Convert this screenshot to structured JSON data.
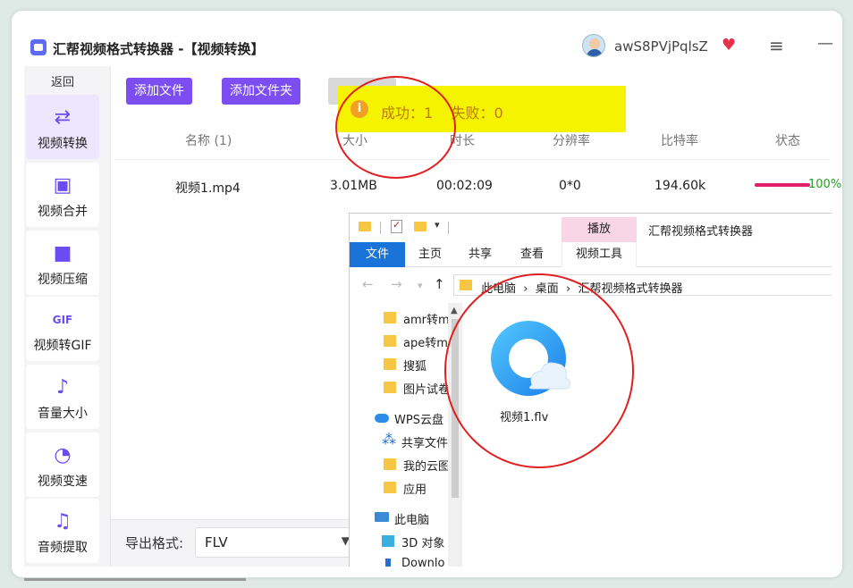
{
  "app": {
    "title": "汇帮视频格式转换器  -【视频转换】",
    "username": "awS8PVjPqlsZ",
    "vip_icon": "heart-diamond-icon",
    "menu_icon": "≡",
    "min_icon": "—"
  },
  "sidebar": {
    "back_label": "返回",
    "items": [
      {
        "label": "视频转换",
        "icon": "video-convert-icon",
        "glyph": "⇄"
      },
      {
        "label": "视频合并",
        "icon": "video-merge-icon",
        "glyph": "▣"
      },
      {
        "label": "视频压缩",
        "icon": "camera-icon",
        "glyph": "■"
      },
      {
        "label": "视频转GIF",
        "icon": "gif-icon",
        "glyph": "GIF"
      },
      {
        "label": "音量大小",
        "icon": "music-note-icon",
        "glyph": "♪"
      },
      {
        "label": "视频变速",
        "icon": "speedometer-icon",
        "glyph": "◔"
      },
      {
        "label": "音频提取",
        "icon": "music-extract-icon",
        "glyph": "♫"
      }
    ]
  },
  "toolbar": {
    "add_file": "添加文件",
    "add_folder": "添加文件夹"
  },
  "toast": {
    "icon": "i",
    "text": "成功：1    失败：0"
  },
  "table": {
    "headers": {
      "name": "名称 (1)",
      "size": "大小",
      "duration": "时长",
      "resolution": "分辨率",
      "bitrate": "比特率",
      "status": "状态"
    },
    "rows": [
      {
        "name": "视频1.mp4",
        "size": "3.01MB",
        "duration": "00:02:09",
        "resolution": "0*0",
        "bitrate": "194.60k",
        "status_text": "100%",
        "progress": 1.0
      }
    ]
  },
  "output": {
    "label": "导出格式:",
    "format": "FLV"
  },
  "explorer": {
    "title": "汇帮视频格式转换器",
    "context_tab": "播放",
    "ribbon_tabs": [
      "文件",
      "主页",
      "共享",
      "查看",
      "视频工具"
    ],
    "breadcrumb": "此电脑  ›  桌面  ›  汇帮视频格式转换器",
    "tree": [
      {
        "label": "amr转m",
        "icon": "folder-icon"
      },
      {
        "label": "ape转mp",
        "icon": "folder-icon"
      },
      {
        "label": "搜狐",
        "icon": "folder-icon"
      },
      {
        "label": "图片试卷",
        "icon": "folder-icon"
      },
      {
        "label": "WPS云盘",
        "icon": "cloud-icon"
      },
      {
        "label": "共享文件",
        "icon": "share-icon"
      },
      {
        "label": "我的云图",
        "icon": "folder-icon"
      },
      {
        "label": "应用",
        "icon": "folder-icon"
      },
      {
        "label": "此电脑",
        "icon": "computer-icon"
      },
      {
        "label": "3D 对象",
        "icon": "cube-icon"
      },
      {
        "label": "Downlo",
        "icon": "download-icon"
      }
    ],
    "file": {
      "name": "视频1.flv",
      "icon": "browser-file-icon"
    }
  },
  "colors": {
    "accent": "#7c4df1",
    "toast_bg": "#f5f300",
    "toast_text": "#b97c00",
    "annotation": "#e02020",
    "progress": "#e0206a",
    "file_tab": "#1a73d9"
  }
}
